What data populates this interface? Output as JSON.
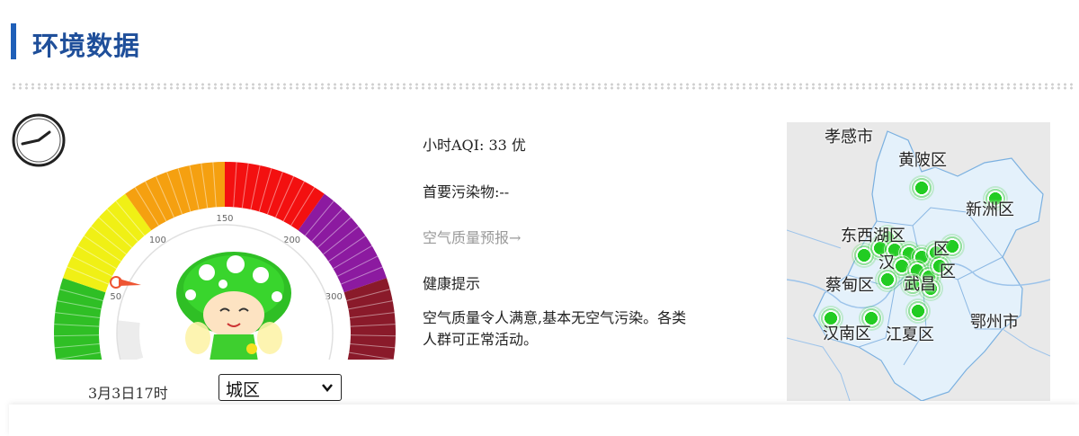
{
  "header": {
    "title": "环境数据"
  },
  "gauge": {
    "ticks": [
      "0",
      "50",
      "100",
      "150",
      "200",
      "300",
      "500"
    ],
    "aqi_value": 33,
    "max_value": 500,
    "colors": [
      "#2fbf25",
      "#f0f015",
      "#f5a010",
      "#f31010",
      "#8c1aa0",
      "#8a1a2a"
    ]
  },
  "selector": {
    "date": "3月3日17时",
    "selected": "城区"
  },
  "info": {
    "hour_aqi": "小时AQI: 33 优",
    "primary_pollutant": "首要污染物:--",
    "forecast_link": "空气质量预报→",
    "health_title": "健康提示",
    "health_text_line1": "空气质量令人满意,基本无空气污染。各类",
    "health_text_line2": "人群可正常活动。"
  },
  "map": {
    "labels": {
      "xiaogan": "孝感市",
      "huangpi": "黄陂区",
      "xinzhou": "新洲区",
      "dongxihu": "东西湖区",
      "caidian": "蔡甸区",
      "hannan": "汉南区",
      "jiangxia": "江夏区",
      "ezhou": "鄂州市",
      "qu1": "区",
      "qu2": "区",
      "hanyang": "汉",
      "wuchang": "武昌"
    },
    "station_color": "#22cc22"
  }
}
